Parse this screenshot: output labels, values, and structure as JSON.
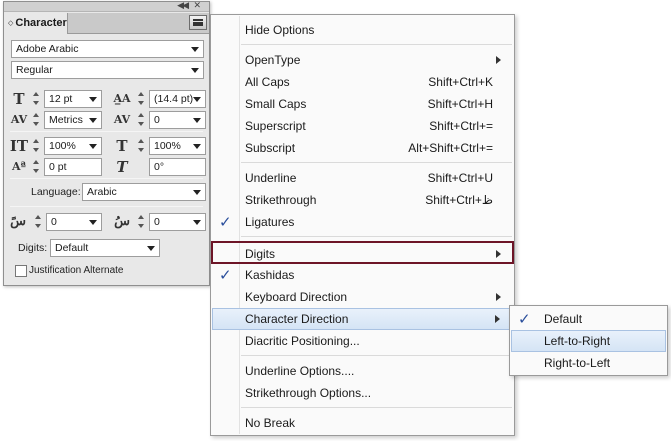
{
  "panel": {
    "tab_label": "Character",
    "font_family": "Adobe Arabic",
    "font_style": "Regular",
    "font_size": "12 pt",
    "leading": "(14.4 pt)",
    "kerning": "Metrics",
    "tracking": "0",
    "vertical_scale": "100%",
    "horizontal_scale": "100%",
    "baseline_shift": "0 pt",
    "skew": "0°",
    "language_label": "Language:",
    "language_value": "Arabic",
    "arabic_field_1": "0",
    "arabic_field_2": "0",
    "digits_label": "Digits:",
    "digits_value": "Default",
    "justification_alternate": "Justification Alternate"
  },
  "menu": {
    "items": [
      {
        "label": "Hide Options",
        "shortcut": ""
      },
      {
        "label": "OpenType",
        "shortcut": ""
      },
      {
        "label": "All Caps",
        "shortcut": "Shift+Ctrl+K"
      },
      {
        "label": "Small Caps",
        "shortcut": "Shift+Ctrl+H"
      },
      {
        "label": "Superscript",
        "shortcut": "Shift+Ctrl+="
      },
      {
        "label": "Subscript",
        "shortcut": "Alt+Shift+Ctrl+="
      },
      {
        "label": "Underline",
        "shortcut": "Shift+Ctrl+U"
      },
      {
        "label": "Strikethrough",
        "shortcut": "Shift+Ctrl+ظ"
      },
      {
        "label": "Ligatures",
        "shortcut": ""
      },
      {
        "label": "Digits",
        "shortcut": ""
      },
      {
        "label": "Kashidas",
        "shortcut": ""
      },
      {
        "label": "Keyboard Direction",
        "shortcut": ""
      },
      {
        "label": "Character Direction",
        "shortcut": ""
      },
      {
        "label": "Diacritic Positioning...",
        "shortcut": ""
      },
      {
        "label": "Underline Options....",
        "shortcut": ""
      },
      {
        "label": "Strikethrough Options...",
        "shortcut": ""
      },
      {
        "label": "No Break",
        "shortcut": ""
      }
    ]
  },
  "submenu": {
    "items": [
      {
        "label": "Default"
      },
      {
        "label": "Left-to-Right"
      },
      {
        "label": "Right-to-Left"
      }
    ]
  },
  "colors": {
    "highlight_box": "#6d1527",
    "hover_bg": "#d5e4f5",
    "check": "#2b4f9c"
  },
  "glyphs": {
    "check": "✓",
    "arabic_icon_1": "سً",
    "arabic_icon_2": "سُ"
  }
}
